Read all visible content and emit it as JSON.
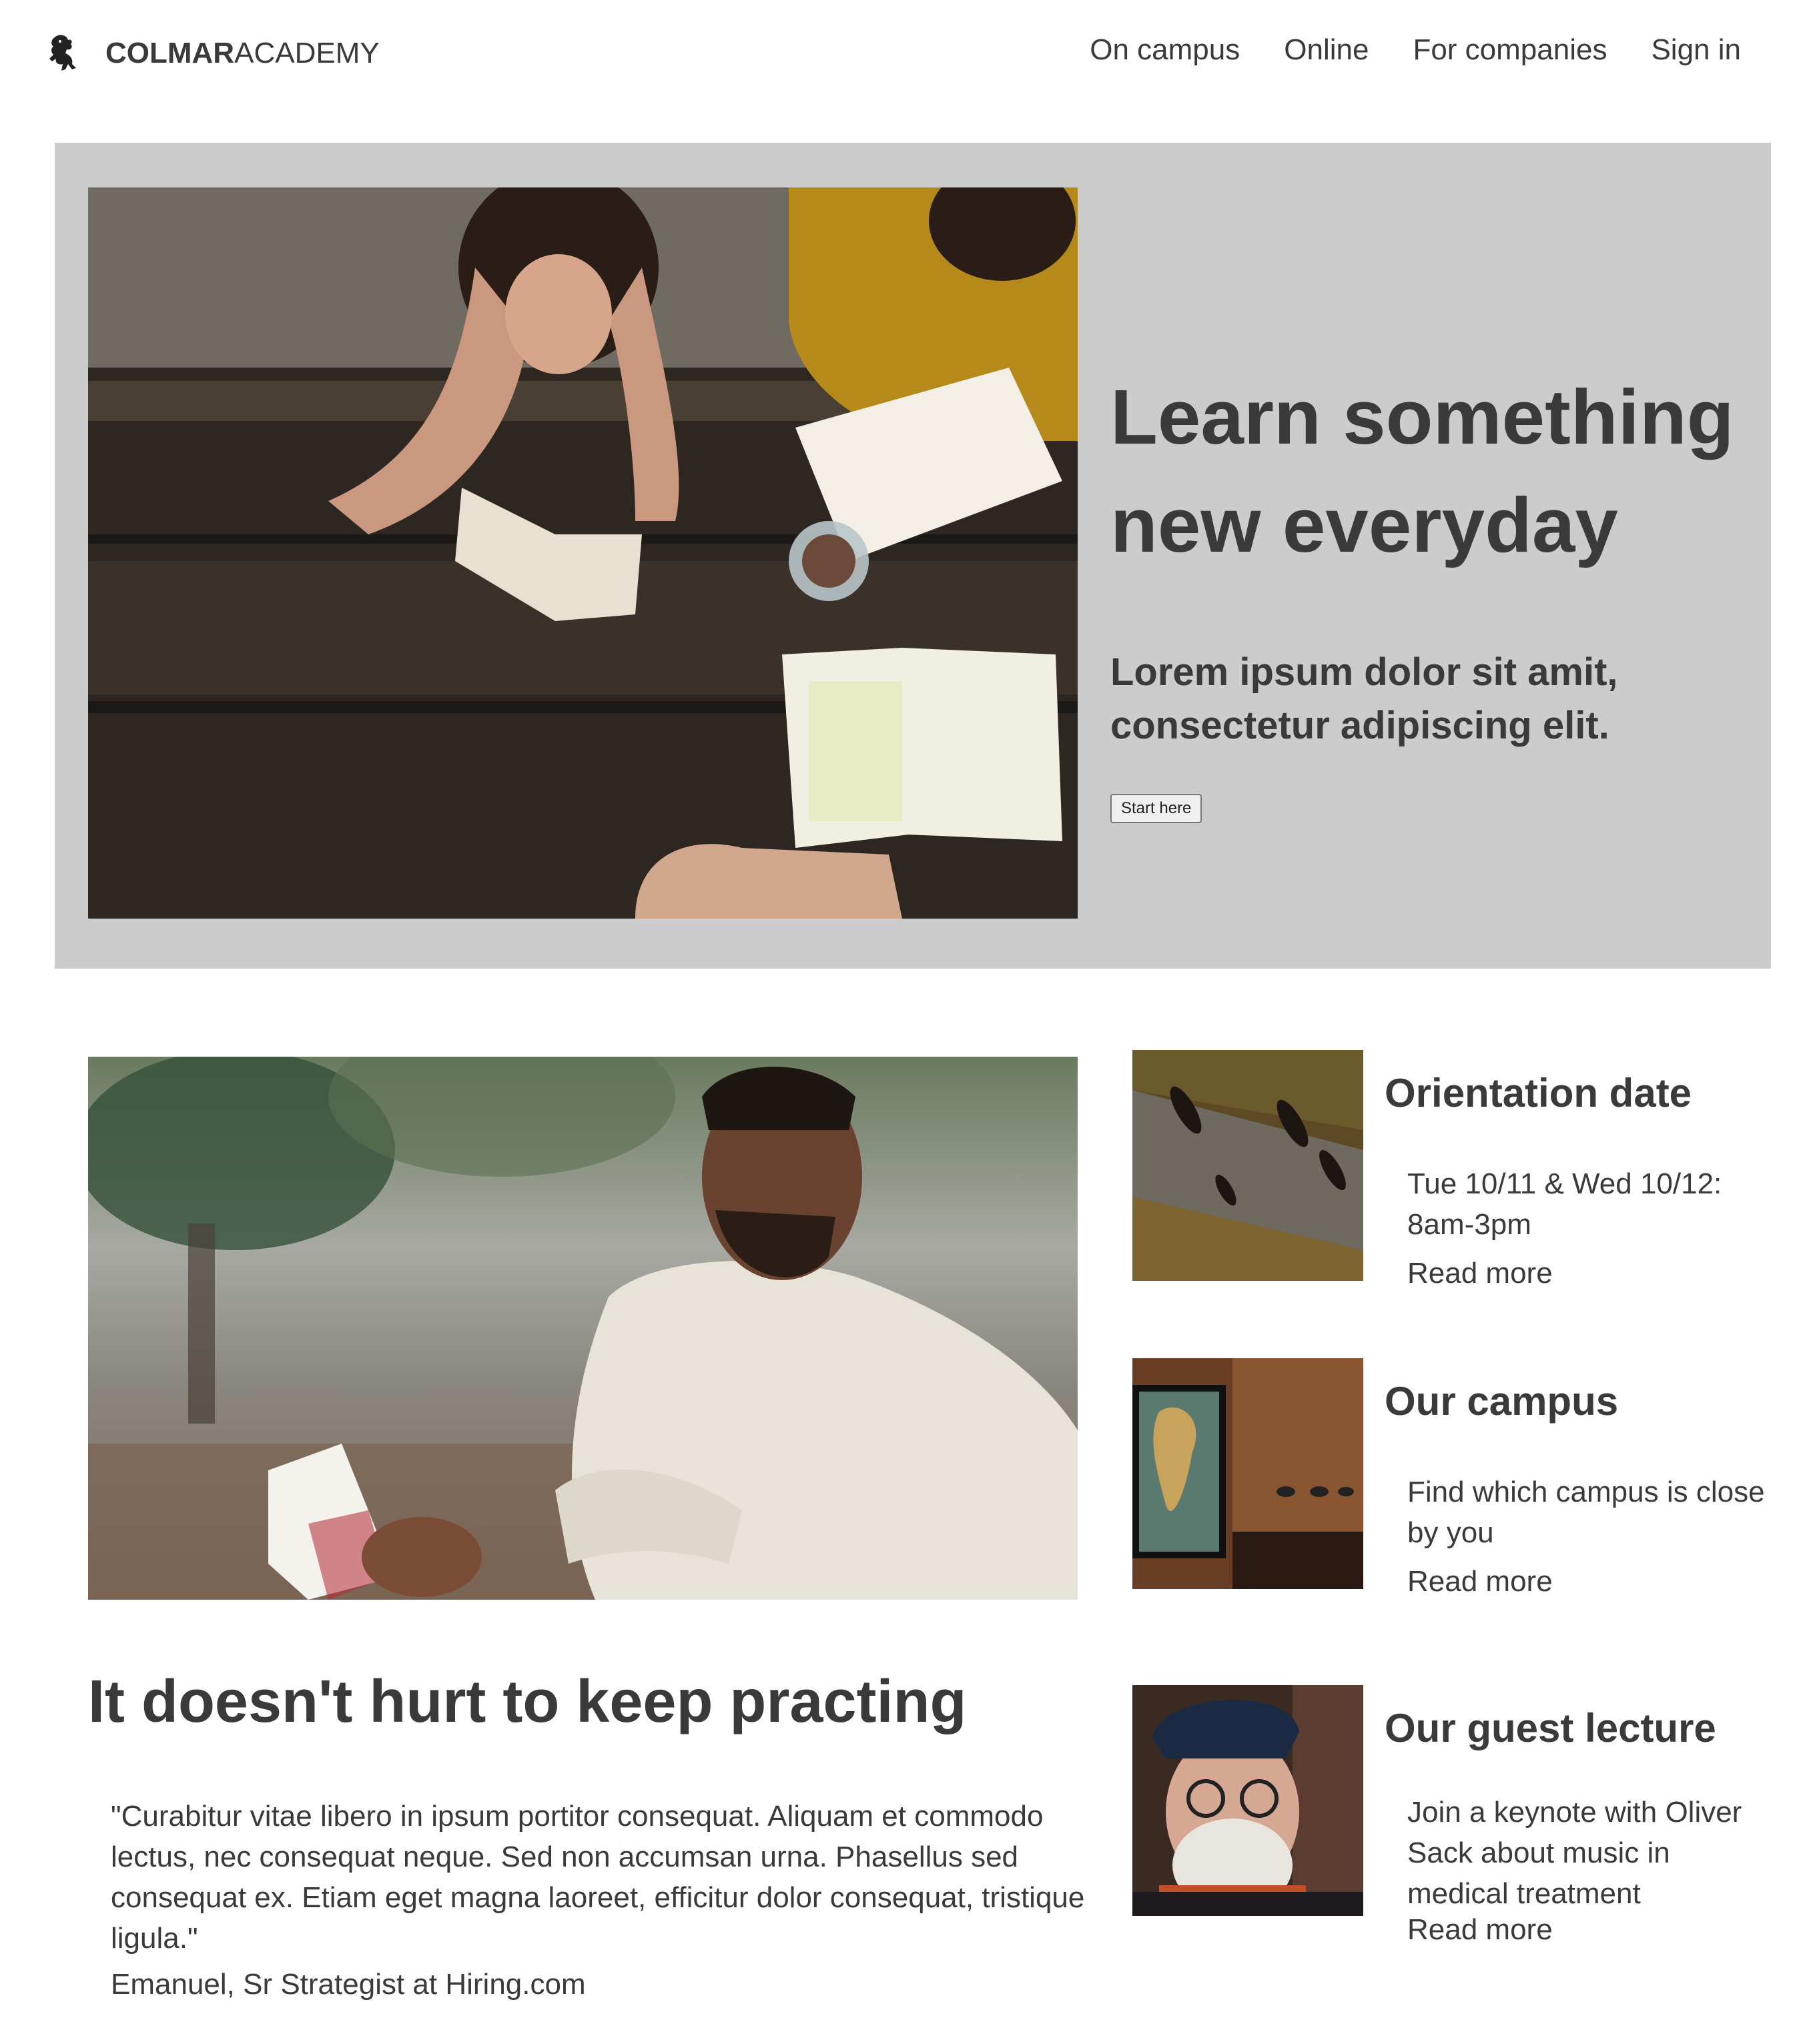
{
  "header": {
    "logo_bold": "COLMAR",
    "logo_light": "ACADEMY",
    "nav": [
      "On campus",
      "Online",
      "For companies",
      "Sign in"
    ]
  },
  "hero": {
    "title": "Learn something new everyday",
    "subtitle": "Lorem ipsum dolor sit amit, consectetur adipiscing elit.",
    "button": "Start here"
  },
  "feature": {
    "title": "It doesn't hurt to keep practing",
    "quote": "\"Curabitur vitae libero in ipsum portitor consequat. Aliquam et commodo lectus, nec consequat neque. Sed non accumsan urna. Phasellus sed consequat ex. Etiam eget magna laoreet, efficitur dolor consequat, tristique ligula.\"",
    "author": "Emanuel, Sr Strategist at Hiring.com"
  },
  "cards": [
    {
      "title": "Orientation date",
      "text": "Tue 10/11 & Wed 10/12: 8am-3pm",
      "link": "Read more"
    },
    {
      "title": "Our campus",
      "text": "Find which campus is close by you",
      "link": "Read more"
    },
    {
      "title": "Our guest lecture",
      "text": "Join a keynote with Oliver Sack about music in medical treatment",
      "link": "Read more"
    }
  ],
  "colors": {
    "text": "#3a3a3a",
    "hero_bg": "#cccccc",
    "page_bg": "#ffffff"
  },
  "icons": {
    "logo": "lion-rampant-icon"
  }
}
